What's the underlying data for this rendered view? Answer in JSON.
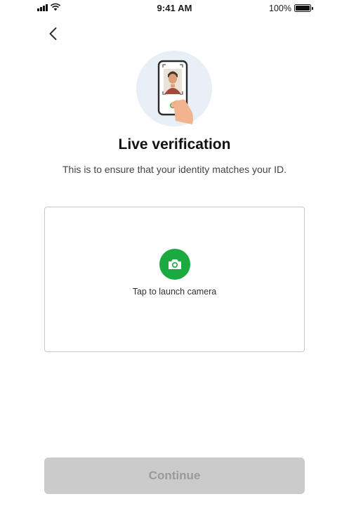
{
  "status_bar": {
    "time": "9:41 AM",
    "battery_percent": "100%",
    "signal_icon": "signal-bars-icon",
    "wifi_icon": "wifi-icon",
    "battery_icon": "battery-full-icon"
  },
  "nav": {
    "back_icon": "chevron-left-icon"
  },
  "illustration": {
    "icon": "phone-selfie-hand-illustration"
  },
  "header": {
    "title": "Live verification",
    "subtitle": "This is to ensure that your identity matches your ID."
  },
  "camera": {
    "icon": "camera-icon",
    "label": "Tap to launch camera",
    "accent_color": "#1aaa3f"
  },
  "footer": {
    "continue_label": "Continue",
    "continue_enabled": false
  }
}
